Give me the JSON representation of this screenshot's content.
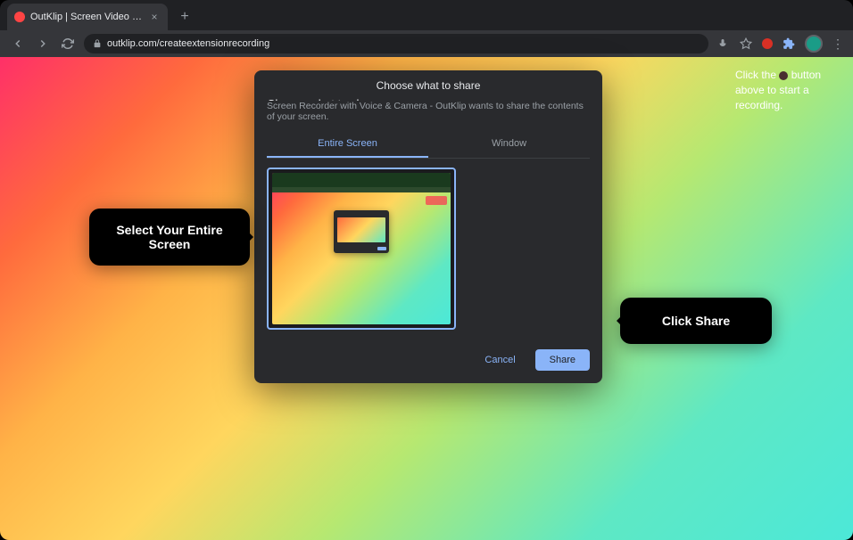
{
  "browser": {
    "tab_title": "OutKlip | Screen Video Record...",
    "url": "outklip.com/createextensionrecording"
  },
  "instruction": {
    "prefix": "Click the",
    "suffix": "button above to start a recording."
  },
  "dialog": {
    "title": "Choose what to share",
    "heading": "Choose what to share",
    "description": "Screen Recorder with Voice & Camera - OutKlip wants to share the contents of your screen.",
    "tabs": {
      "entire_screen": "Entire Screen",
      "window": "Window"
    },
    "actions": {
      "cancel": "Cancel",
      "share": "Share"
    }
  },
  "callouts": {
    "select_screen": "Select Your Entire Screen",
    "click_share": "Click Share"
  }
}
